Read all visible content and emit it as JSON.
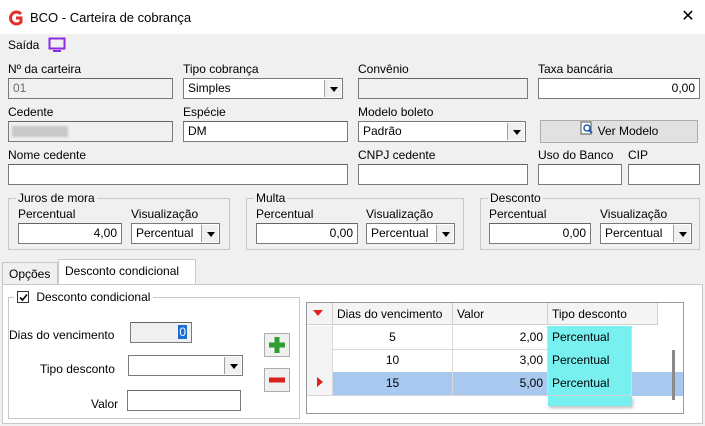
{
  "window": {
    "title": "BCO - Carteira de cobrança"
  },
  "toolbar": {
    "exit_label": "Saída"
  },
  "fields": {
    "numero_label": "Nº da carteira",
    "numero_value": "01",
    "tipo_label": "Tipo cobrança",
    "tipo_value": "Simples",
    "convenio_label": "Convênio",
    "taxa_label": "Taxa bancária",
    "taxa_value": "0,00",
    "cedente_label": "Cedente",
    "especie_label": "Espécie",
    "especie_value": "DM",
    "modelo_label": "Modelo boleto",
    "modelo_value": "Padrão",
    "ver_modelo_label": "Ver Modelo",
    "nome_cedente_label": "Nome cedente",
    "cnpj_label": "CNPJ cedente",
    "uso_banco_label": "Uso do Banco",
    "cip_label": "CIP"
  },
  "juros": {
    "title": "Juros de mora",
    "pct_label": "Percentual",
    "pct_value": "4,00",
    "vis_label": "Visualização",
    "vis_value": "Percentual"
  },
  "multa": {
    "title": "Multa",
    "pct_label": "Percentual",
    "pct_value": "0,00",
    "vis_label": "Visualização",
    "vis_value": "Percentual"
  },
  "desconto": {
    "title": "Desconto",
    "pct_label": "Percentual",
    "pct_value": "0,00",
    "vis_label": "Visualização",
    "vis_value": "Percentual"
  },
  "tabs": [
    {
      "label": "Opções"
    },
    {
      "label": "Desconto condicional"
    }
  ],
  "cond": {
    "checkbox_label": "Desconto condicional",
    "dias_label": "Dias do vencimento",
    "dias_value": "0",
    "tipo_label": "Tipo desconto",
    "valor_label": "Valor"
  },
  "grid": {
    "headers": [
      "Dias do vencimento",
      "Valor",
      "Tipo desconto"
    ],
    "rows": [
      {
        "dias": "5",
        "valor": "2,00",
        "tipo": "Percentual"
      },
      {
        "dias": "10",
        "valor": "3,00",
        "tipo": "Percentual"
      },
      {
        "dias": "15",
        "valor": "5,00",
        "tipo": "Percentual"
      }
    ]
  },
  "colors": {
    "accent": "#e74c3c",
    "add": "#2e9e2e",
    "remove": "#d9201c",
    "selected_row": "#a8c8f0",
    "highlight": "#78f0f0"
  }
}
